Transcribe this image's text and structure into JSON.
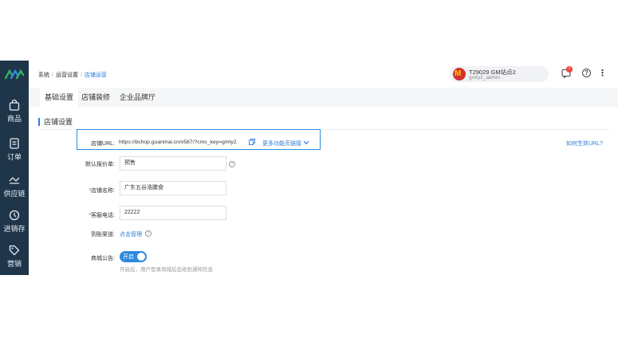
{
  "sidebar": {
    "items": [
      {
        "label": "商品",
        "icon": "shopping-bag-icon"
      },
      {
        "label": "订单",
        "icon": "order-icon"
      },
      {
        "label": "供应链",
        "icon": "supply-chain-icon"
      },
      {
        "label": "进销存",
        "icon": "inventory-icon"
      },
      {
        "label": "营销",
        "icon": "marketing-tag-icon"
      }
    ]
  },
  "breadcrumb": {
    "items": [
      "系统",
      "运营设置",
      "店铺运营"
    ]
  },
  "account": {
    "avatar_glyph": "M",
    "name": "T29029 GM站点2",
    "username": "gmty2_admin"
  },
  "header": {
    "message_count": "7",
    "help_glyph": "?",
    "more_glyph": "⋮"
  },
  "tabs": [
    {
      "label": "基础设置",
      "active": true
    },
    {
      "label": "店铺装修",
      "active": false
    },
    {
      "label": "企业品牌厅",
      "active": false
    }
  ],
  "section": {
    "title": "店铺设置"
  },
  "form": {
    "url": {
      "label": "店铺URL:",
      "value": "https://bshop.guanmai.cn/v587/?cms_key=gmty2",
      "more_label": "更多功能页链接",
      "help_label": "如何生效URL?"
    },
    "default_quote": {
      "label": "默认报价单:",
      "value": "预售"
    },
    "shop_name": {
      "required": "*",
      "label": "店铺名称:",
      "value": "广东五谷浩膳食"
    },
    "service_phone": {
      "required": "*",
      "label": "客服电话:",
      "value": "22222"
    },
    "payment_channel": {
      "label": "到账渠道:",
      "link_label": "点击管理"
    },
    "announcement": {
      "label": "商城公告:",
      "toggle_label": "开启",
      "enabled": true,
      "hint": "开启后，用户登录商城后会收到通知信息"
    }
  },
  "colors": {
    "sidebar_bg": "#1f3549",
    "accent": "#2d7bdb",
    "required": "#e53935"
  }
}
